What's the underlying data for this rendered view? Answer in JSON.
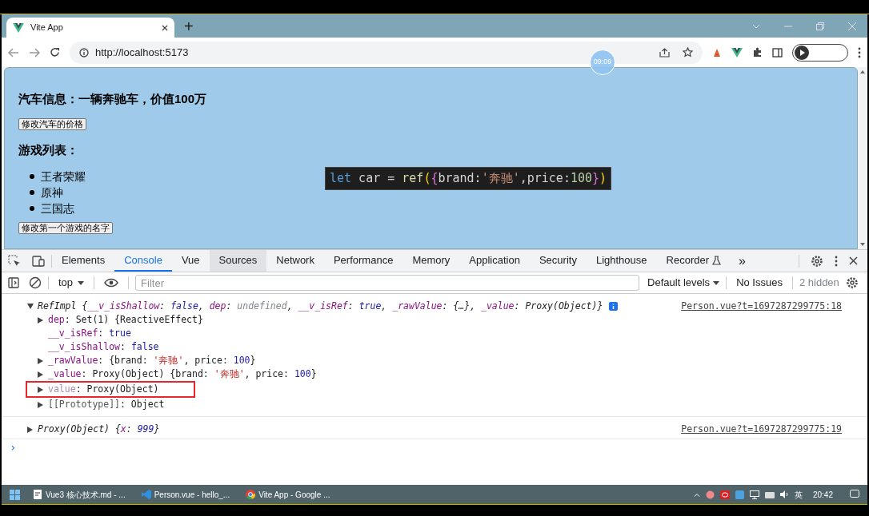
{
  "browser": {
    "tabs": [
      {
        "title": "Vite App",
        "selected": true
      }
    ],
    "new_tab": "+",
    "address": {
      "url": "http://localhost:5173"
    },
    "timer": "09:09"
  },
  "page": {
    "car_heading": "汽车信息：一辆奔驰车，价值100万",
    "car_button": "修改汽车的价格",
    "games_heading": "游戏列表：",
    "games": [
      "王者荣耀",
      "原神",
      "三国志"
    ],
    "games_button": "修改第一个游戏的名字",
    "code_overlay": [
      {
        "text": "let",
        "kind": "keyword"
      },
      {
        "text": " car = ",
        "kind": "plain"
      },
      {
        "text": "ref",
        "kind": "function"
      },
      {
        "text": "(",
        "kind": "paren"
      },
      {
        "text": "{",
        "kind": "brace"
      },
      {
        "text": "brand:",
        "kind": "plain"
      },
      {
        "text": "'奔驰'",
        "kind": "string"
      },
      {
        "text": ",price:",
        "kind": "plain"
      },
      {
        "text": "100",
        "kind": "number"
      },
      {
        "text": "}",
        "kind": "brace"
      },
      {
        "text": ")",
        "kind": "paren"
      }
    ]
  },
  "devtools": {
    "tabs": [
      {
        "label": "Elements",
        "selected": false,
        "hovered": false
      },
      {
        "label": "Console",
        "selected": true,
        "hovered": false
      },
      {
        "label": "Vue",
        "selected": false,
        "hovered": false
      },
      {
        "label": "Sources",
        "selected": false,
        "hovered": true
      },
      {
        "label": "Network",
        "selected": false,
        "hovered": false
      },
      {
        "label": "Performance",
        "selected": false,
        "hovered": false
      },
      {
        "label": "Memory",
        "selected": false,
        "hovered": false
      },
      {
        "label": "Application",
        "selected": false,
        "hovered": false
      },
      {
        "label": "Security",
        "selected": false,
        "hovered": false
      },
      {
        "label": "Lighthouse",
        "selected": false,
        "hovered": false
      },
      {
        "label": "Recorder",
        "selected": false,
        "hovered": false
      }
    ],
    "more_tabs": "»",
    "context": "top",
    "filter": {
      "placeholder": "Filter"
    },
    "levels": "Default levels",
    "issues": "No Issues",
    "hidden": "2 hidden",
    "entries": [
      {
        "expanded": true,
        "source": "Person.vue?t=1697287299775:18",
        "summary": [
          {
            "text": "RefImpl {",
            "kind": "plain"
          },
          {
            "text": "__v_isShallow",
            "kind": "key"
          },
          {
            "text": ": ",
            "kind": "plain"
          },
          {
            "text": "false",
            "kind": "keyword"
          },
          {
            "text": ", ",
            "kind": "plain"
          },
          {
            "text": "dep",
            "kind": "key"
          },
          {
            "text": ": ",
            "kind": "plain"
          },
          {
            "text": "undefined",
            "kind": "undefined"
          },
          {
            "text": ", ",
            "kind": "plain"
          },
          {
            "text": "__v_isRef",
            "kind": "key"
          },
          {
            "text": ": ",
            "kind": "plain"
          },
          {
            "text": "true",
            "kind": "keyword"
          },
          {
            "text": ", ",
            "kind": "plain"
          },
          {
            "text": "_rawValue",
            "kind": "key"
          },
          {
            "text": ": {…}, ",
            "kind": "plain"
          },
          {
            "text": "_value",
            "kind": "key"
          },
          {
            "text": ": Proxy(Object)}",
            "kind": "plain"
          }
        ],
        "children": [
          {
            "expandable": true,
            "highlighted": false,
            "tokens": [
              {
                "text": "dep",
                "kind": "key"
              },
              {
                "text": ": Set(1) {ReactiveEffect}",
                "kind": "plain"
              }
            ]
          },
          {
            "expandable": false,
            "highlighted": false,
            "tokens": [
              {
                "text": "__v_isRef",
                "kind": "key"
              },
              {
                "text": ": ",
                "kind": "plain"
              },
              {
                "text": "true",
                "kind": "keyword"
              }
            ]
          },
          {
            "expandable": false,
            "highlighted": false,
            "tokens": [
              {
                "text": "__v_isShallow",
                "kind": "key"
              },
              {
                "text": ": ",
                "kind": "plain"
              },
              {
                "text": "false",
                "kind": "keyword"
              }
            ]
          },
          {
            "expandable": true,
            "highlighted": false,
            "tokens": [
              {
                "text": "_rawValue",
                "kind": "key"
              },
              {
                "text": ": {brand: ",
                "kind": "plain"
              },
              {
                "text": "'奔驰'",
                "kind": "string"
              },
              {
                "text": ", price: ",
                "kind": "plain"
              },
              {
                "text": "100",
                "kind": "number"
              },
              {
                "text": "}",
                "kind": "plain"
              }
            ]
          },
          {
            "expandable": true,
            "highlighted": false,
            "tokens": [
              {
                "text": "_value",
                "kind": "key"
              },
              {
                "text": ": Proxy(Object) {brand: ",
                "kind": "plain"
              },
              {
                "text": "'奔驰'",
                "kind": "string"
              },
              {
                "text": ", price: ",
                "kind": "plain"
              },
              {
                "text": "100",
                "kind": "number"
              },
              {
                "text": "}",
                "kind": "plain"
              }
            ]
          },
          {
            "expandable": true,
            "highlighted": true,
            "tokens": [
              {
                "text": "value",
                "kind": "getter"
              },
              {
                "text": ": Proxy(Object)",
                "kind": "plain"
              }
            ]
          },
          {
            "expandable": true,
            "highlighted": false,
            "tokens": [
              {
                "text": "[[Prototype]]",
                "kind": "internal"
              },
              {
                "text": ": Object",
                "kind": "plain"
              }
            ]
          }
        ]
      },
      {
        "expanded": false,
        "source": "Person.vue?t=1697287299775:19",
        "summary": [
          {
            "text": "Proxy(Object) {",
            "kind": "plain"
          },
          {
            "text": "x",
            "kind": "key"
          },
          {
            "text": ": ",
            "kind": "plain"
          },
          {
            "text": "999",
            "kind": "number"
          },
          {
            "text": "}",
            "kind": "plain"
          }
        ]
      }
    ],
    "prompt": "›"
  },
  "taskbar": {
    "items": [
      {
        "label": "Vue3 核心技术.md - ...",
        "kind": "typora"
      },
      {
        "label": "Person.vue - hello_...",
        "kind": "vscode"
      },
      {
        "label": "Vite App - Google ...",
        "kind": "chrome"
      }
    ],
    "language": "英",
    "time": "20:42"
  }
}
